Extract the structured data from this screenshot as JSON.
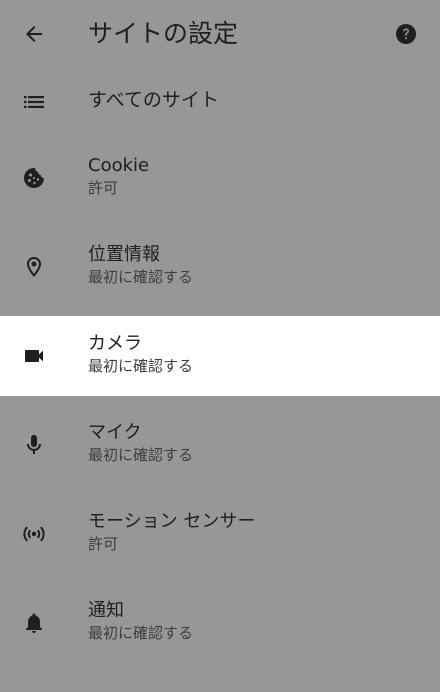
{
  "app_bar": {
    "title": "サイトの設定",
    "back_icon": "arrow-left-icon",
    "help_icon": "help-circle-icon"
  },
  "items": [
    {
      "icon": "list-icon",
      "title": "すべてのサイト",
      "subtitle": ""
    },
    {
      "icon": "cookie-icon",
      "title": "Cookie",
      "subtitle": "許可"
    },
    {
      "icon": "location-pin-icon",
      "title": "位置情報",
      "subtitle": "最初に確認する"
    },
    {
      "icon": "videocam-icon",
      "title": "カメラ",
      "subtitle": "最初に確認する",
      "highlighted": true
    },
    {
      "icon": "mic-icon",
      "title": "マイク",
      "subtitle": "最初に確認する"
    },
    {
      "icon": "motion-sensor-icon",
      "title": "モーション センサー",
      "subtitle": "許可"
    },
    {
      "icon": "bell-icon",
      "title": "通知",
      "subtitle": "最初に確認する"
    }
  ],
  "colors": {
    "dim_overlay": "#979797",
    "highlight_row": "#ffffff",
    "text_primary": "#1f1f1f",
    "text_secondary": "#3d3d3d"
  }
}
